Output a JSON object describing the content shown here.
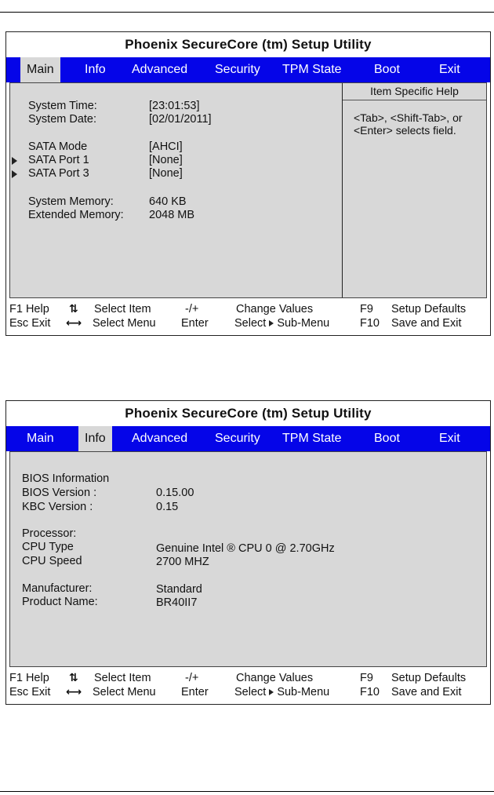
{
  "screen1": {
    "title": "Phoenix SecureCore (tm) Setup Utility",
    "menu": [
      "Main",
      "Info",
      "Advanced",
      "Security",
      "TPM State",
      "Boot",
      "Exit"
    ],
    "active_tab": "Main",
    "fields": {
      "system_time_label": "System Time:",
      "system_time_value": "[23:01:53]",
      "system_date_label": "System Date:",
      "system_date_value": "[02/01/2011]",
      "sata_mode_label": "SATA Mode",
      "sata_mode_value": "[AHCI]",
      "sata_port1_label": "SATA Port 1",
      "sata_port1_value": "[None]",
      "sata_port3_label": "SATA Port 3",
      "sata_port3_value": "[None]",
      "system_memory_label": "System Memory:",
      "system_memory_value": "640 KB",
      "extended_memory_label": "Extended Memory:",
      "extended_memory_value": "2048 MB"
    },
    "help": {
      "title": "Item Specific Help",
      "text": "<Tab>, <Shift-Tab>, or <Enter> selects field."
    }
  },
  "screen2": {
    "title": "Phoenix SecureCore (tm) Setup Utility",
    "menu": [
      "Main",
      "Info",
      "Advanced",
      "Security",
      "TPM State",
      "Boot",
      "Exit"
    ],
    "active_tab": "Info",
    "fields": {
      "bios_info": "BIOS Information",
      "bios_version_label": "BIOS Version :",
      "bios_version_value": "0.15.00",
      "kbc_version_label": "KBC Version  :",
      "kbc_version_value": "0.15",
      "processor": "Processor:",
      "cpu_type_label": "CPU Type",
      "cpu_type_value": "Genuine Intel ® CPU 0  @ 2.70GHz",
      "cpu_speed_label": "CPU Speed",
      "cpu_speed_value": "2700 MHZ",
      "manufacturer_label": "Manufacturer:",
      "manufacturer_value": "Standard",
      "product_name_label": "Product Name:",
      "product_name_value": "BR40II7"
    }
  },
  "keybar": {
    "f1": "F1 Help",
    "select_item": "Select Item",
    "minus_plus": "-/+",
    "change_values": "Change Values",
    "f9": "F9",
    "setup_defaults": "Setup Defaults",
    "esc": "Esc Exit",
    "select_menu": "Select Menu",
    "enter": "Enter",
    "select_sub_a": "Select",
    "select_sub_b": "Sub-Menu",
    "f10": "F10",
    "save_exit": "Save and Exit"
  }
}
